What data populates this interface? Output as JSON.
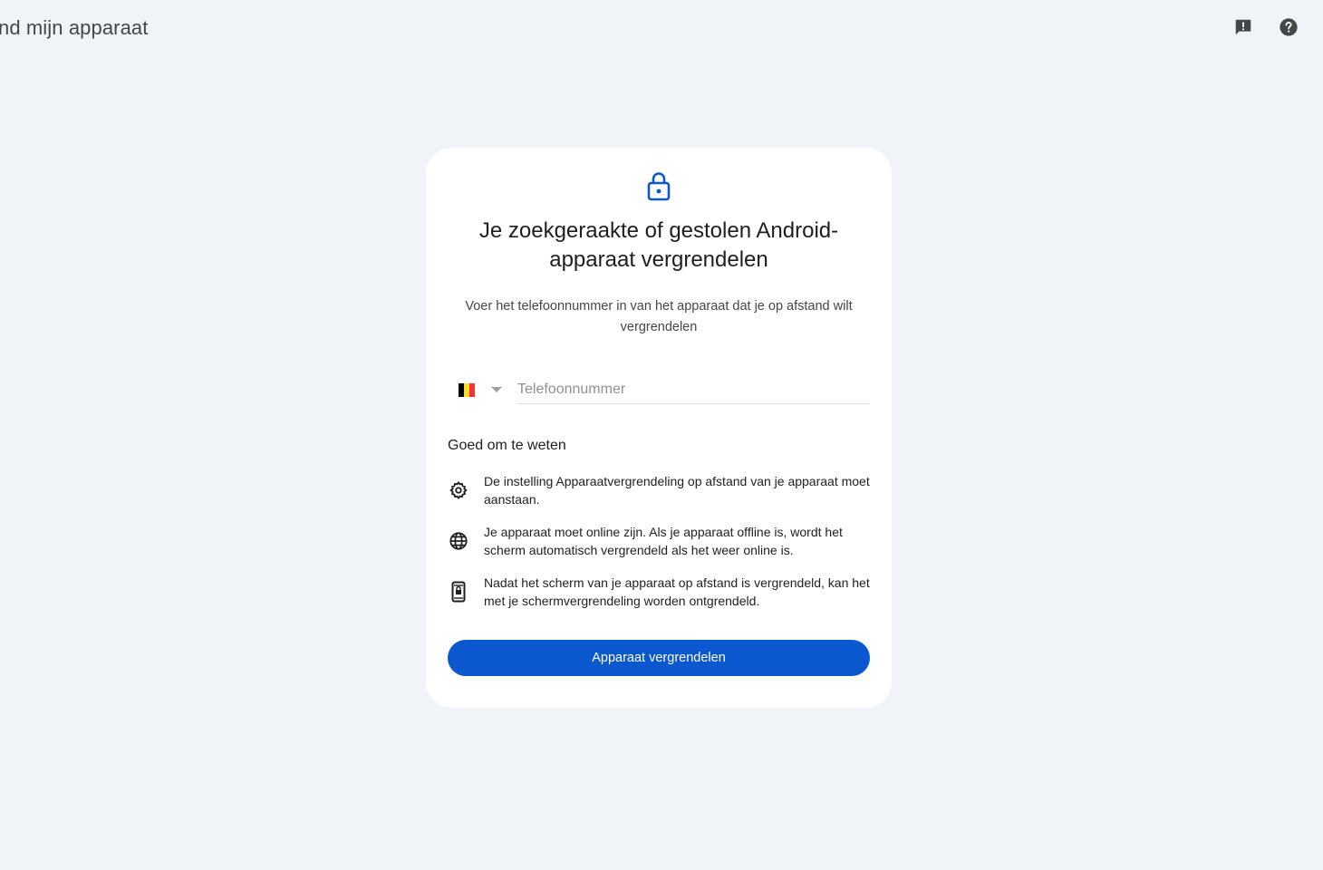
{
  "header": {
    "app_title": "nd mijn apparaat",
    "feedback_icon": "feedback-icon",
    "help_icon": "help-icon"
  },
  "card": {
    "icon": "lock-icon",
    "title": "Je zoekgeraakte of gestolen Android-apparaat vergrendelen",
    "subtitle": "Voer het telefoonnummer in van het apparaat dat je op afstand wilt vergrendelen",
    "phone": {
      "country_flag": "belgium-flag-icon",
      "placeholder": "Telefoonnummer",
      "value": ""
    },
    "good_to_know": {
      "heading": "Goed om te weten",
      "items": [
        {
          "icon": "settings-icon",
          "text": "De instelling Apparaatvergrendeling op afstand van je apparaat moet aanstaan."
        },
        {
          "icon": "globe-icon",
          "text": "Je apparaat moet online zijn. Als je apparaat offline is, wordt het scherm automatisch vergrendeld als het weer online is."
        },
        {
          "icon": "phone-lock-icon",
          "text": "Nadat het scherm van je apparaat op afstand is vergrendeld, kan het met je schermvergrendeling worden ontgrendeld."
        }
      ]
    },
    "button_label": "Apparaat vergrendelen"
  },
  "colors": {
    "background": "#f0f4f9",
    "accent": "#0b57d0",
    "icon_grey": "#5f6368",
    "flag_black": "#000000",
    "flag_yellow": "#fdda24",
    "flag_red": "#ef3340"
  }
}
